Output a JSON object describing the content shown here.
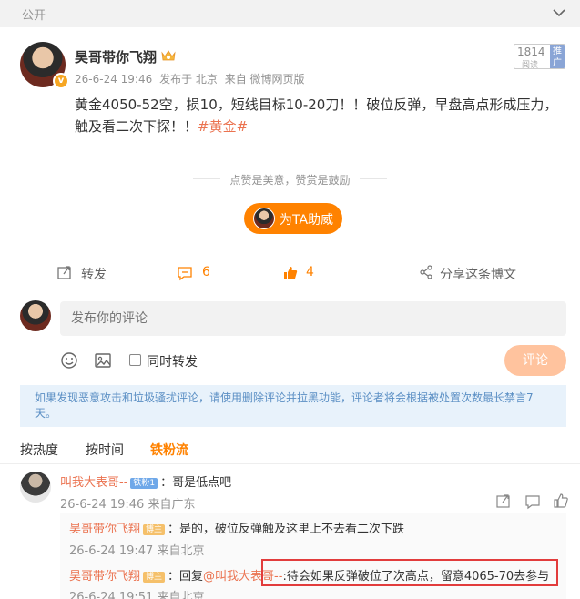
{
  "topbar": {
    "privacy": "公开"
  },
  "post": {
    "author": "昊哥带你飞翔",
    "time": "26-6-24 19:46",
    "published_at": "发布于 北京",
    "source": "来自 微博网页版",
    "reads": {
      "count": "1814",
      "unit": "阅读",
      "promo": "推广"
    },
    "content": "黄金4050-52空，损10，短线目标10-20刀！！破位反弹，早盘高点形成压力，触及看二次下探！！",
    "hashtag": "#黄金#",
    "reward_text": "点赞是美意，赞赏是鼓励",
    "boost_label": "为TA助威",
    "actions": {
      "repost": "转发",
      "comments": "6",
      "likes": "4",
      "share": "分享这条博文"
    }
  },
  "composer": {
    "placeholder": "发布你的评论",
    "repost_label": "同时转发",
    "submit_label": "评论"
  },
  "notice": "如果发现恶意攻击和垃圾骚扰评论，请使用删除评论并拉黑功能，评论者将会根据被处置次数最长禁言7天。",
  "sort": {
    "hot": "按热度",
    "time": "按时间",
    "fans": "铁粉流"
  },
  "comments": [
    {
      "user": "叫我大表哥--",
      "badge": "铁粉1",
      "text": "：哥是低点吧",
      "time": "26-6-24 19:46",
      "location": "来自广东",
      "replies": [
        {
          "user": "昊哥带你飞翔",
          "badge": "博主",
          "text": "：是的，破位反弹触及这里上不去看二次下跌",
          "time": "26-6-24 19:47",
          "location": "来自北京"
        },
        {
          "user": "昊哥带你飞翔",
          "badge": "博主",
          "reply_prefix": "：回复",
          "mention": "@叫我大表哥--",
          "text": ":待会如果反弹破位了次高点，留意4065-70去参与",
          "time": "26-6-24 19:51",
          "location": "来自北京"
        }
      ]
    }
  ],
  "colors": {
    "accent": "#ff8200",
    "link": "#eb7350",
    "highlight_box": "#e23c3c"
  }
}
